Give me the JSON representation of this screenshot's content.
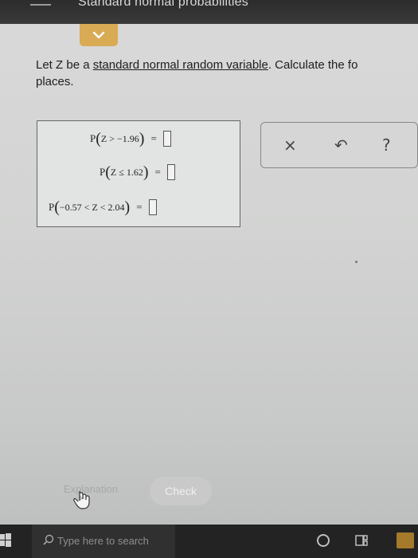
{
  "window": {
    "title": "Standard normal probabilities"
  },
  "question": {
    "line1_prefix": "Let Z be a ",
    "line1_link": "standard normal random variable",
    "line1_suffix": ". Calculate the fo",
    "line2": "places."
  },
  "rows": [
    {
      "left": "P",
      "open": "(",
      "expr": "Z > −1.96",
      "close": ")",
      "eq": "="
    },
    {
      "left": "P",
      "open": "(",
      "expr": "Z ≤ 1.62",
      "close": ")",
      "eq": "="
    },
    {
      "left": "P",
      "open": "(",
      "expr": "−0.57 < Z < 2.04",
      "close": ")",
      "eq": "="
    }
  ],
  "tools": {
    "clear": "×",
    "undo": "↶",
    "help": "?"
  },
  "buttons": {
    "explanation": "Explanation",
    "check": "Check"
  },
  "taskbar": {
    "search_placeholder": "Type here to search"
  },
  "colors": {
    "accent": "#d9ab55",
    "title_bar": "#2c2c2c",
    "taskbar": "#232323"
  }
}
